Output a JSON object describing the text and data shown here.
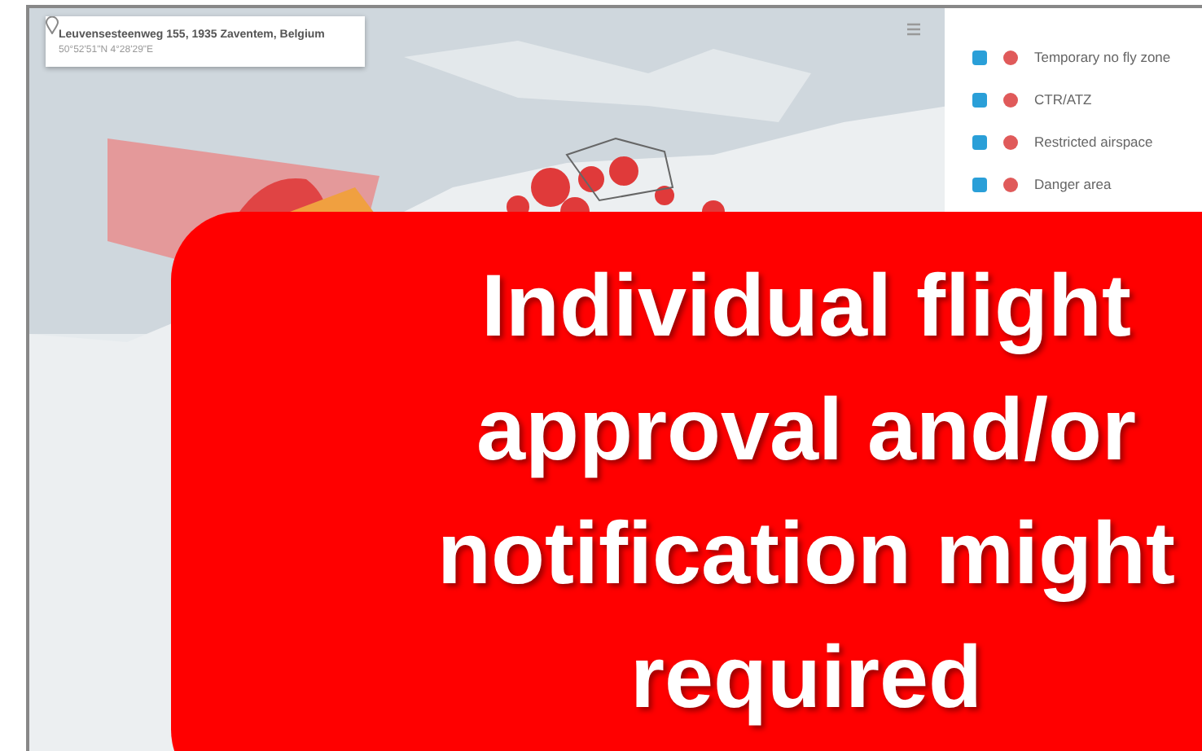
{
  "search_card": {
    "address": "Leuvensesteenweg 155, 1935 Zaventem, Belgium",
    "coordinates": "50°52'51\"N 4°28'29\"E"
  },
  "layers": [
    {
      "label": "Temporary no fly zone",
      "checked": true,
      "color": "#e05a5a"
    },
    {
      "label": "CTR/ATZ",
      "checked": true,
      "color": "#e05a5a"
    },
    {
      "label": "Restricted airspace",
      "checked": true,
      "color": "#e05a5a"
    },
    {
      "label": "Danger area",
      "checked": true,
      "color": "#e05a5a"
    }
  ],
  "callout": {
    "lines": [
      "Individual flight",
      "approval and/or",
      "notification might",
      "required"
    ]
  }
}
